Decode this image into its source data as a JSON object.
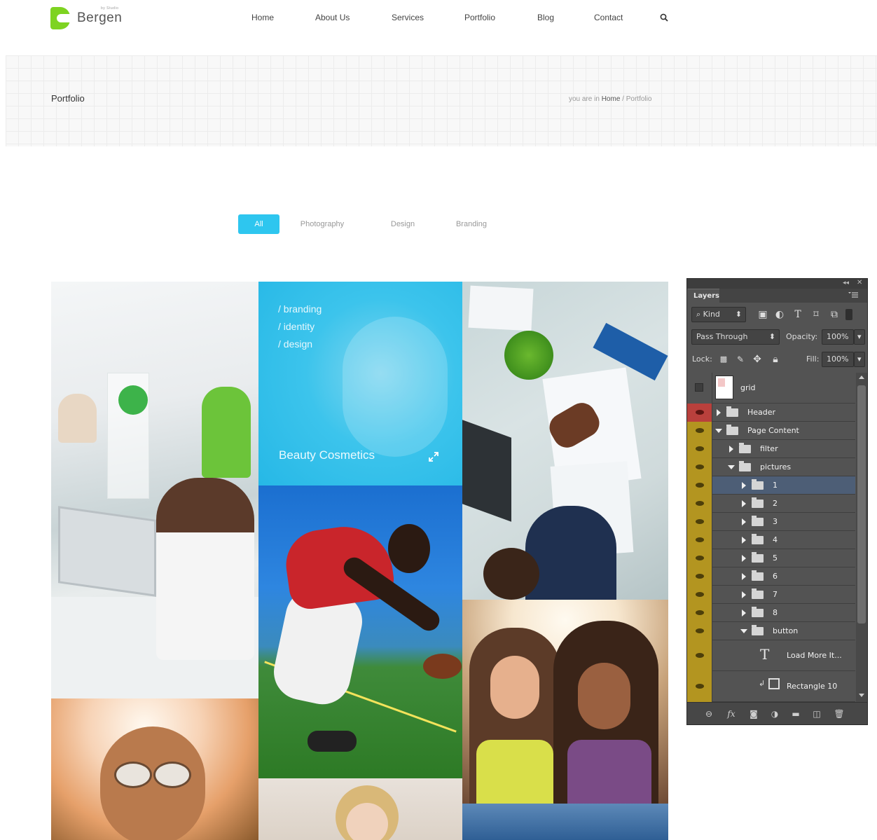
{
  "site": {
    "brand": "Bergen",
    "brand_tag": "by Studio",
    "nav": [
      "Home",
      "About Us",
      "Services",
      "Portfolio",
      "Blog",
      "Contact"
    ],
    "search_icon": "search-icon"
  },
  "title_bar": {
    "title": "Portfolio",
    "breadcrumb_prefix": "you are in ",
    "breadcrumb_home": "Home",
    "breadcrumb_sep": " / ",
    "breadcrumb_current": "Portfolio"
  },
  "filters": {
    "items": [
      "All",
      "Photography",
      "Design",
      "Branding"
    ],
    "active": "All",
    "accent_color": "#2ec6ef"
  },
  "portfolio": {
    "featured": {
      "tags": [
        "/ branding",
        "/ identity",
        "/ design"
      ],
      "caption": "Beauty Cosmetics",
      "expand_icon": "expand-icon"
    }
  },
  "layers_panel": {
    "tab": "Layers",
    "filter_kind": "Kind",
    "blend_mode": "Pass Through",
    "opacity_label": "Opacity:",
    "opacity_value": "100%",
    "lock_label": "Lock:",
    "fill_label": "Fill:",
    "fill_value": "100%",
    "layers": [
      {
        "name": "grid",
        "type": "smart-object",
        "visible": false
      },
      {
        "name": "Header",
        "type": "group",
        "expanded": false,
        "visible": true,
        "color": "red"
      },
      {
        "name": "Page Content",
        "type": "group",
        "expanded": true,
        "visible": true,
        "color": "yellow"
      },
      {
        "name": "filter",
        "type": "group",
        "expanded": false,
        "visible": true
      },
      {
        "name": "pictures",
        "type": "group",
        "expanded": true,
        "visible": true
      },
      {
        "name": "1",
        "type": "group",
        "expanded": false,
        "visible": true,
        "selected": true
      },
      {
        "name": "2",
        "type": "group",
        "expanded": false,
        "visible": true
      },
      {
        "name": "3",
        "type": "group",
        "expanded": false,
        "visible": true
      },
      {
        "name": "4",
        "type": "group",
        "expanded": false,
        "visible": true
      },
      {
        "name": "5",
        "type": "group",
        "expanded": false,
        "visible": true
      },
      {
        "name": "6",
        "type": "group",
        "expanded": false,
        "visible": true
      },
      {
        "name": "7",
        "type": "group",
        "expanded": false,
        "visible": true
      },
      {
        "name": "8",
        "type": "group",
        "expanded": false,
        "visible": true
      },
      {
        "name": "button",
        "type": "group",
        "expanded": true,
        "visible": true
      },
      {
        "name": "Load More It...",
        "type": "text",
        "visible": true
      },
      {
        "name": "Rectangle 10",
        "type": "shape",
        "visible": true
      }
    ],
    "footer_icons": [
      "link-icon",
      "fx-icon",
      "mask-icon",
      "adjustment-icon",
      "folder-icon",
      "new-layer-icon",
      "trash-icon"
    ]
  }
}
